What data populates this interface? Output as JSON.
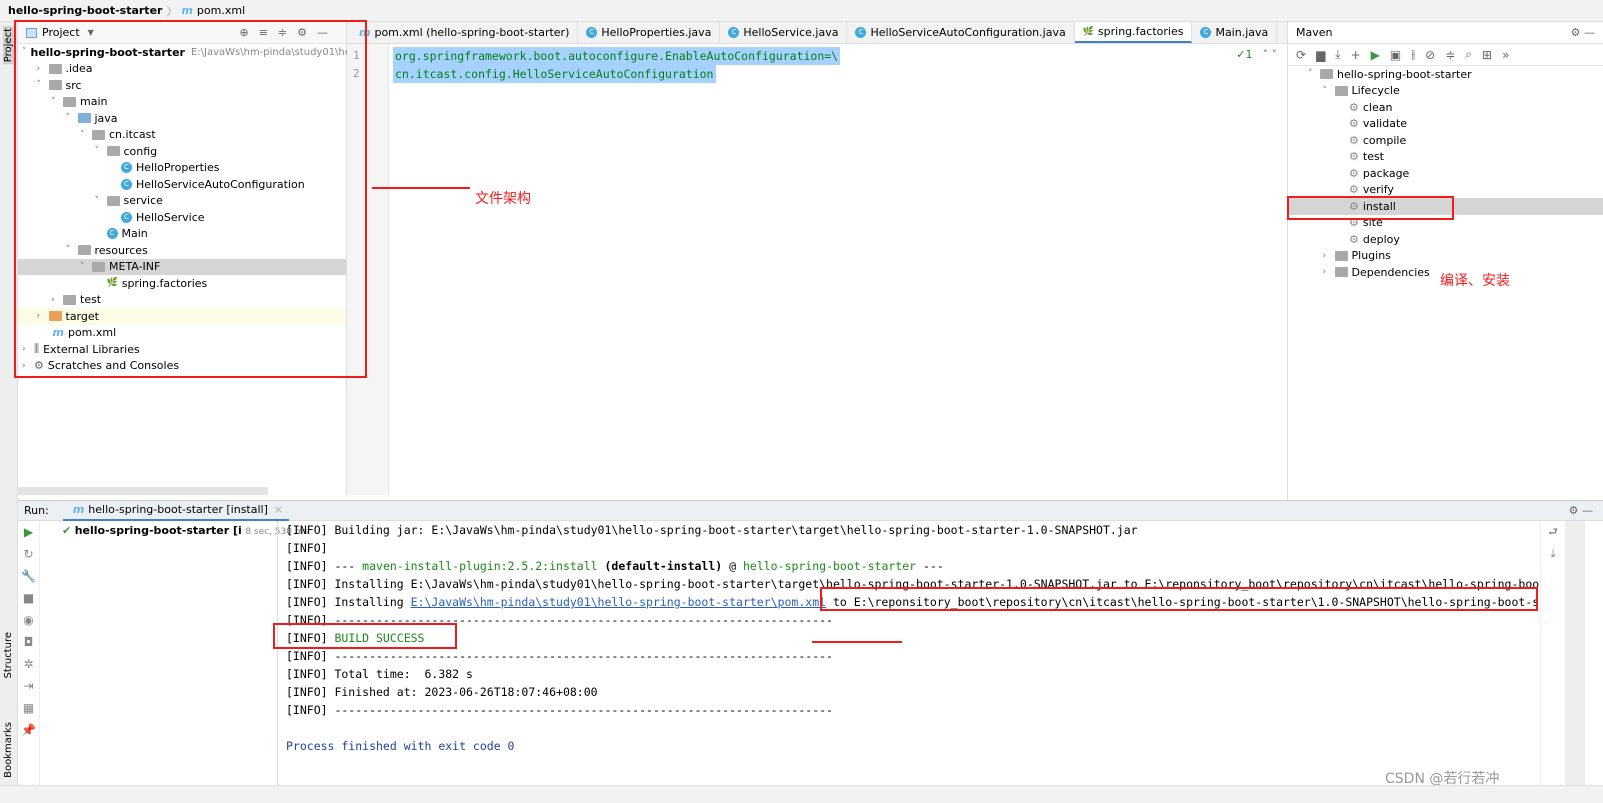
{
  "breadcrumb": {
    "project": "hello-spring-boot-starter",
    "file": "pom.xml"
  },
  "left_stripe": {
    "project": "Project",
    "structure": "Structure",
    "bookmarks": "Bookmarks"
  },
  "project_panel": {
    "title": "Project",
    "tree": [
      {
        "label": "hello-spring-boot-starter",
        "path": "E:\\JavaWs\\hm-pinda\\study01\\hello",
        "depth": 0,
        "icon": "module",
        "open": true,
        "bold": true
      },
      {
        "label": ".idea",
        "depth": 1,
        "icon": "folder",
        "open": false
      },
      {
        "label": "src",
        "depth": 1,
        "icon": "folder",
        "open": true
      },
      {
        "label": "main",
        "depth": 2,
        "icon": "folder",
        "open": true
      },
      {
        "label": "java",
        "depth": 3,
        "icon": "folder-blue",
        "open": true
      },
      {
        "label": "cn.itcast",
        "depth": 4,
        "icon": "package",
        "open": true
      },
      {
        "label": "config",
        "depth": 5,
        "icon": "package",
        "open": true
      },
      {
        "label": "HelloProperties",
        "depth": 6,
        "icon": "class"
      },
      {
        "label": "HelloServiceAutoConfiguration",
        "depth": 6,
        "icon": "class"
      },
      {
        "label": "service",
        "depth": 5,
        "icon": "package",
        "open": true
      },
      {
        "label": "HelloService",
        "depth": 6,
        "icon": "class"
      },
      {
        "label": "Main",
        "depth": 5,
        "icon": "class"
      },
      {
        "label": "resources",
        "depth": 3,
        "icon": "folder",
        "open": true
      },
      {
        "label": "META-INF",
        "depth": 4,
        "icon": "folder",
        "open": true,
        "selected": true
      },
      {
        "label": "spring.factories",
        "depth": 5,
        "icon": "spring"
      },
      {
        "label": "test",
        "depth": 2,
        "icon": "folder",
        "open": false
      },
      {
        "label": "target",
        "depth": 1,
        "icon": "folder-orange",
        "open": false,
        "highlight": true
      },
      {
        "label": "pom.xml",
        "depth": 1,
        "icon": "maven"
      },
      {
        "label": "External Libraries",
        "depth": 0,
        "icon": "library",
        "open": false
      },
      {
        "label": "Scratches and Consoles",
        "depth": 0,
        "icon": "scratch",
        "open": false
      }
    ]
  },
  "editor_tabs": [
    {
      "label": "pom.xml (hello-spring-boot-starter)",
      "icon": "maven"
    },
    {
      "label": "HelloProperties.java",
      "icon": "class"
    },
    {
      "label": "HelloService.java",
      "icon": "class"
    },
    {
      "label": "HelloServiceAutoConfiguration.java",
      "icon": "class"
    },
    {
      "label": "spring.factories",
      "icon": "spring",
      "active": true
    },
    {
      "label": "Main.java",
      "icon": "class"
    }
  ],
  "editor": {
    "lines": [
      "org.springframework.boot.autoconfigure.EnableAutoConfiguration=\\",
      "  cn.itcast.config.HelloServiceAutoConfiguration"
    ],
    "line_numbers": [
      "1",
      "2"
    ],
    "inspection": "✓1"
  },
  "maven": {
    "title": "Maven",
    "tree": [
      {
        "label": "hello-spring-boot-starter",
        "depth": 0,
        "open": true
      },
      {
        "label": "Lifecycle",
        "depth": 1,
        "open": true
      },
      {
        "label": "clean",
        "depth": 2,
        "goal": true
      },
      {
        "label": "validate",
        "depth": 2,
        "goal": true
      },
      {
        "label": "compile",
        "depth": 2,
        "goal": true
      },
      {
        "label": "test",
        "depth": 2,
        "goal": true
      },
      {
        "label": "package",
        "depth": 2,
        "goal": true
      },
      {
        "label": "verify",
        "depth": 2,
        "goal": true
      },
      {
        "label": "install",
        "depth": 2,
        "goal": true,
        "selected": true
      },
      {
        "label": "site",
        "depth": 2,
        "goal": true
      },
      {
        "label": "deploy",
        "depth": 2,
        "goal": true
      },
      {
        "label": "Plugins",
        "depth": 1,
        "open": false
      },
      {
        "label": "Dependencies",
        "depth": 1,
        "open": false
      }
    ]
  },
  "run": {
    "label": "Run:",
    "tab": "hello-spring-boot-starter [install]",
    "tree_item": "hello-spring-boot-starter [i",
    "duration": "8 sec, 530 ms",
    "console": [
      {
        "t": "[INFO] Building jar: E:\\JavaWs\\hm-pinda\\study01\\hello-spring-boot-starter\\target\\hello-spring-boot-starter-1.0-SNAPSHOT.jar"
      },
      {
        "t": "[INFO]"
      },
      {
        "t": "[INFO] --- ",
        "g": "maven-install-plugin:2.5.2:install",
        "b2": " (default-install)",
        "at": " @ ",
        "p": "hello-spring-boot-starter",
        "e": " ---"
      },
      {
        "t": "[INFO] Installing E:\\JavaWs\\hm-pinda\\study01\\hello-spring-boot-starter\\target\\hello-spring-boot-starter-1.0-SNAPSHOT.jar to E:\\reponsitory_boot\\repository\\cn\\itcast\\hello-spring-boot-starter\\"
      },
      {
        "t": "[INFO] Installing ",
        "link": "E:\\JavaWs\\hm-pinda\\study01\\hello-spring-boot-starter\\pom.xml",
        "e": " to E:\\reponsitory_boot\\repository\\cn\\itcast\\hello-spring-boot-starter\\1.0-SNAPSHOT\\hello-spring-boot-starter-1.0"
      },
      {
        "t": "[INFO] ------------------------------------------------------------------------"
      },
      {
        "t": "[INFO] ",
        "g": "BUILD SUCCESS"
      },
      {
        "t": "[INFO] ------------------------------------------------------------------------"
      },
      {
        "t": "[INFO] Total time:  6.382 s"
      },
      {
        "t": "[INFO] Finished at: 2023-06-26T18:07:46+08:00"
      },
      {
        "t": "[INFO] ------------------------------------------------------------------------"
      },
      {
        "t": ""
      },
      {
        "t": "Process finished with exit code 0",
        "blue": true
      }
    ]
  },
  "annotations": {
    "file_structure": "文件架构",
    "compile_install": "编译、安装"
  },
  "watermark": "CSDN @若行若冲",
  "colors": {
    "annotation": "#f01c1c",
    "selection": "#a6d2ff",
    "success": "#1a8a1a"
  }
}
